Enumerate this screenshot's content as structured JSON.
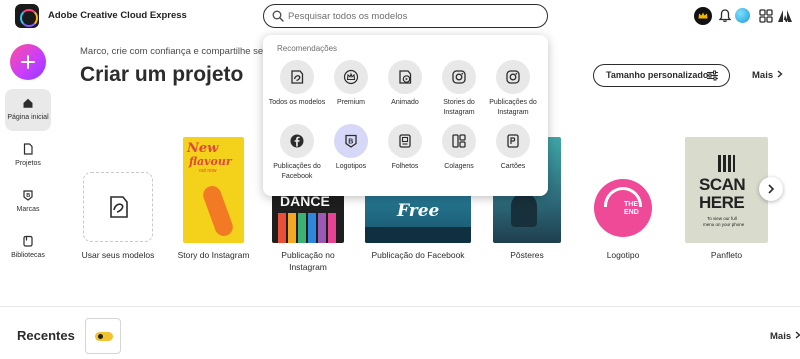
{
  "app": {
    "title": "Adobe Creative Cloud Express"
  },
  "search": {
    "placeholder": "Pesquisar todos os modelos"
  },
  "topbar_icons": [
    "crown-icon",
    "bell-icon",
    "avatar",
    "apps-grid-icon",
    "adobe-logo-icon"
  ],
  "sidebar": {
    "items": [
      {
        "label": "Página inicial",
        "icon": "home-icon",
        "active": true
      },
      {
        "label": "Projetos",
        "icon": "file-icon",
        "active": false
      },
      {
        "label": "Marcas",
        "icon": "brand-icon",
        "active": false
      },
      {
        "label": "Bibliotecas",
        "icon": "library-icon",
        "active": false
      }
    ]
  },
  "main": {
    "greeting": "Marco, crie com confiança e compartilhe sem m",
    "heading": "Criar um projeto",
    "custom_size_label": "Tamanho personalizado",
    "more_label": "Mais",
    "templates": [
      {
        "label": "Usar seus modelos"
      },
      {
        "label": "Story do Instagram",
        "thumb_text_1": "New",
        "thumb_text_2": "flavour",
        "thumb_text_3": "out now"
      },
      {
        "label": "Publicação no Instagram",
        "thumb_text_1": "DANCE"
      },
      {
        "label": "Publicação do Facebook",
        "thumb_text_1": "Free"
      },
      {
        "label": "Pôsteres"
      },
      {
        "label": "Logotipo",
        "thumb_text_1": "THE",
        "thumb_text_2": "END"
      },
      {
        "label": "Panfleto",
        "thumb_text_1": "SCAN",
        "thumb_text_2": "HERE",
        "thumb_text_3": "To view our full",
        "thumb_text_4": "menu on your phone"
      }
    ]
  },
  "recommendations": {
    "title": "Recomendações",
    "items": [
      {
        "label": "Todos os modelos",
        "icon": "templates-icon"
      },
      {
        "label": "Premium",
        "icon": "crown-icon"
      },
      {
        "label": "Animado",
        "icon": "animated-icon"
      },
      {
        "label": "Stories do Instagram",
        "icon": "instagram-icon"
      },
      {
        "label": "Publicações do Instagram",
        "icon": "instagram-icon"
      },
      {
        "label": "Publicações do Facebook",
        "icon": "facebook-icon"
      },
      {
        "label": "Logotipos",
        "icon": "logo-b-icon",
        "selected": true
      },
      {
        "label": "Folhetos",
        "icon": "flyer-icon"
      },
      {
        "label": "Colagens",
        "icon": "collage-icon"
      },
      {
        "label": "Cartões",
        "icon": "card-icon"
      }
    ]
  },
  "recents": {
    "title": "Recentes",
    "more_label": "Mais"
  },
  "colors": {
    "accent_gradient_start": "#ff4f9e",
    "accent_gradient_end": "#8a3cff",
    "text": "#2c2c2c",
    "selected_bg": "#d7d7f7"
  }
}
